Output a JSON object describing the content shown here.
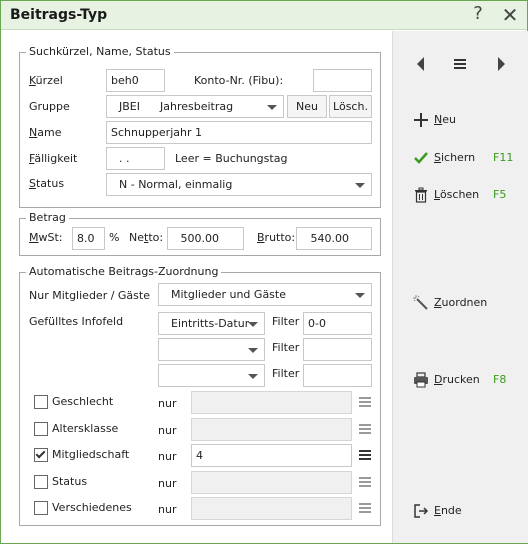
{
  "window": {
    "title": "Beitrags-Typ",
    "help_glyph": "?",
    "close_glyph": "✕"
  },
  "suche": {
    "legend": "Suchkürzel, Name, Status",
    "kuerzel_label_u": "K",
    "kuerzel_label_rest": "ürzel",
    "kuerzel_value": "beh0",
    "konto_label": "Konto-Nr. (Fibu):",
    "konto_value": "",
    "gruppe_label": "Gruppe",
    "gruppe_code": "JBEI",
    "gruppe_name": "Jahresbeitrag",
    "neu_label": "Neu",
    "loesch_label": "Lösch.",
    "name_label_u": "N",
    "name_label_rest": "ame",
    "name_value": "Schnupperjahr 1",
    "faellig_label_u": "F",
    "faellig_label_rest": "älligkeit",
    "faellig_value": ". .",
    "faellig_hint": "Leer = Buchungstag",
    "status_label_u": "S",
    "status_label_rest": "tatus",
    "status_value": "N - Normal, einmalig"
  },
  "betrag": {
    "legend": "Betrag",
    "mwst_label_u": "M",
    "mwst_label_rest": "wSt:",
    "mwst_value": "8.0",
    "mwst_unit": "%",
    "netto_label_a": "Ne",
    "netto_label_u": "t",
    "netto_label_rest": "to:",
    "netto_value": "500.00",
    "brutto_label_u": "B",
    "brutto_label_rest": "rutto:",
    "brutto_value": "540.00"
  },
  "zuordnung": {
    "legend": "Automatische Beitrags-Zuordnung",
    "nur_mitglieder_label": "Nur Mitglieder / Gäste",
    "nur_mitglieder_value": "Mitglieder und Gäste",
    "infofeld_label": "Gefülltes Infofeld",
    "infofeld_1": "Eintritts-Datum",
    "filter_label": "Filter",
    "filter_1": "0-0",
    "infofeld_2": "",
    "filter_2": "",
    "infofeld_3": "",
    "filter_3": "",
    "nur_label": "nur",
    "rows": [
      {
        "label": "Geschlecht",
        "checked": false,
        "value": ""
      },
      {
        "label": "Altersklasse",
        "checked": false,
        "value": ""
      },
      {
        "label": "Mitgliedschaft",
        "checked": true,
        "value": "4"
      },
      {
        "label": "Status",
        "checked": false,
        "value": ""
      },
      {
        "label": "Verschiedenes",
        "checked": false,
        "value": ""
      }
    ]
  },
  "sidebar": {
    "neu_u": "N",
    "neu_rest": "eu",
    "sichern_u": "S",
    "sichern_rest": "ichern",
    "sichern_key": "F11",
    "loeschen_u": "L",
    "loeschen_rest": "öschen",
    "loeschen_key": "F5",
    "zuordnen_u": "Z",
    "zuordnen_rest": "uordnen",
    "drucken_u": "D",
    "drucken_rest": "rucken",
    "drucken_key": "F8",
    "ende_u": "E",
    "ende_rest": "nde",
    "accent_color": "#3a9a1e"
  }
}
